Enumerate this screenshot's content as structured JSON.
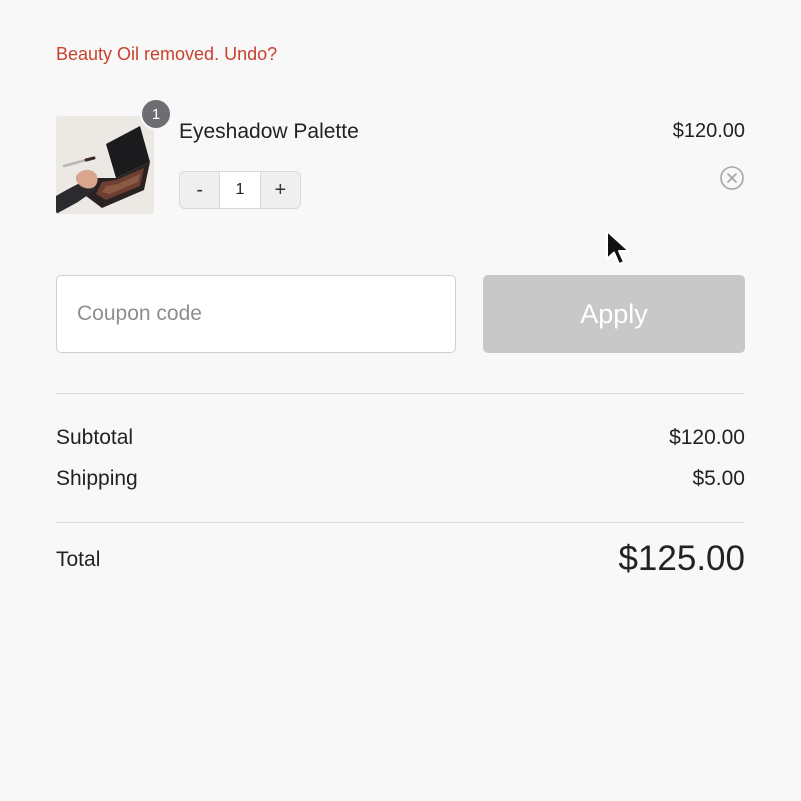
{
  "notice": {
    "message": "Beauty Oil removed.",
    "undo_label": "Undo?"
  },
  "cart": {
    "items": [
      {
        "name": "Eyeshadow Palette",
        "price": "$120.00",
        "quantity": "1",
        "badge_count": "1",
        "decrement_label": "-",
        "increment_label": "+"
      }
    ]
  },
  "coupon": {
    "placeholder": "Coupon code",
    "value": "",
    "apply_label": "Apply"
  },
  "summary": {
    "subtotal_label": "Subtotal",
    "subtotal_value": "$120.00",
    "shipping_label": "Shipping",
    "shipping_value": "$5.00",
    "total_label": "Total",
    "total_value": "$125.00"
  },
  "colors": {
    "notice_text": "#c8412c",
    "apply_disabled_bg": "#c8c8c8",
    "badge_bg": "#6e6e72",
    "page_bg": "#f8f8f8"
  },
  "icons": {
    "remove": "close-circle-icon",
    "pointer": "mouse-pointer-icon"
  }
}
